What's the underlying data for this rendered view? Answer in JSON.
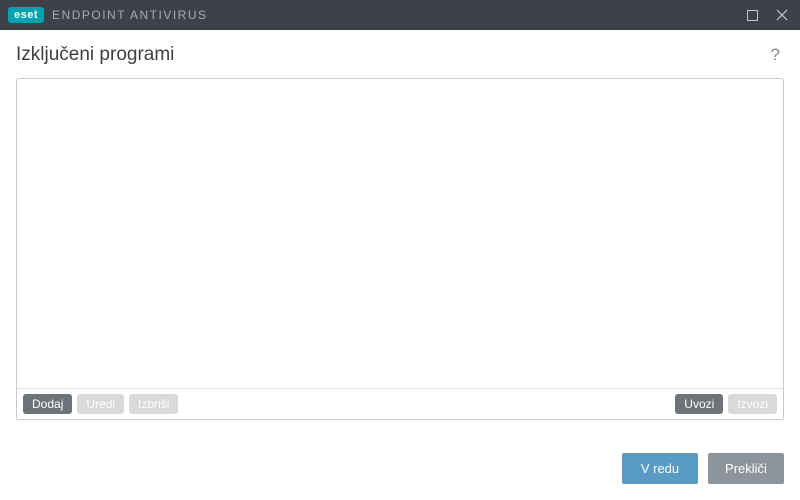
{
  "titlebar": {
    "logo_text": "eset",
    "product_name": "ENDPOINT ANTIVIRUS"
  },
  "header": {
    "title": "Izključeni programi"
  },
  "list": {
    "items": []
  },
  "list_actions": {
    "add": "Dodaj",
    "edit": "Uredi",
    "delete": "Izbriši",
    "import": "Uvozi",
    "export": "Izvozi"
  },
  "footer": {
    "ok": "V redu",
    "cancel": "Prekliči"
  }
}
